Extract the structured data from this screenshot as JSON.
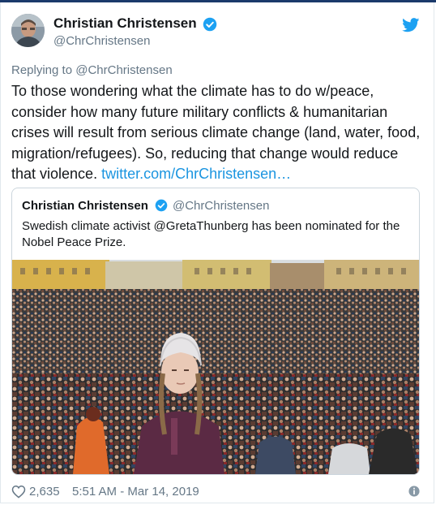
{
  "tweet": {
    "author_name": "Christian Christensen",
    "author_handle": "@ChrChristensen",
    "reply_prefix": "Replying to ",
    "reply_handle": "@ChrChristensen",
    "text": "To those wondering what the climate has to do w/peace, consider how  many future military conflicts & humanitarian crises will result from serious climate change (land, water, food, migration/refugees). So, reducing that change would reduce that violence. ",
    "link_text": "twitter.com/ChrChristensen…"
  },
  "quoted_tweet": {
    "author_name": "Christian Christensen",
    "author_handle": "@ChrChristensen",
    "text": "Swedish climate activist @GretaThunberg has been nominated for the Nobel Peace Prize."
  },
  "footer": {
    "likes": "2,635",
    "timestamp": "5:51 AM - Mar 14, 2019"
  },
  "icons": {
    "verified": "verified-badge-icon",
    "brand": "twitter-bird-icon",
    "like": "heart-icon",
    "info": "info-icon"
  },
  "colors": {
    "brand": "#1da1f2",
    "link": "#1b95e0",
    "secondary_text": "#657786",
    "primary_text": "#14171a"
  }
}
